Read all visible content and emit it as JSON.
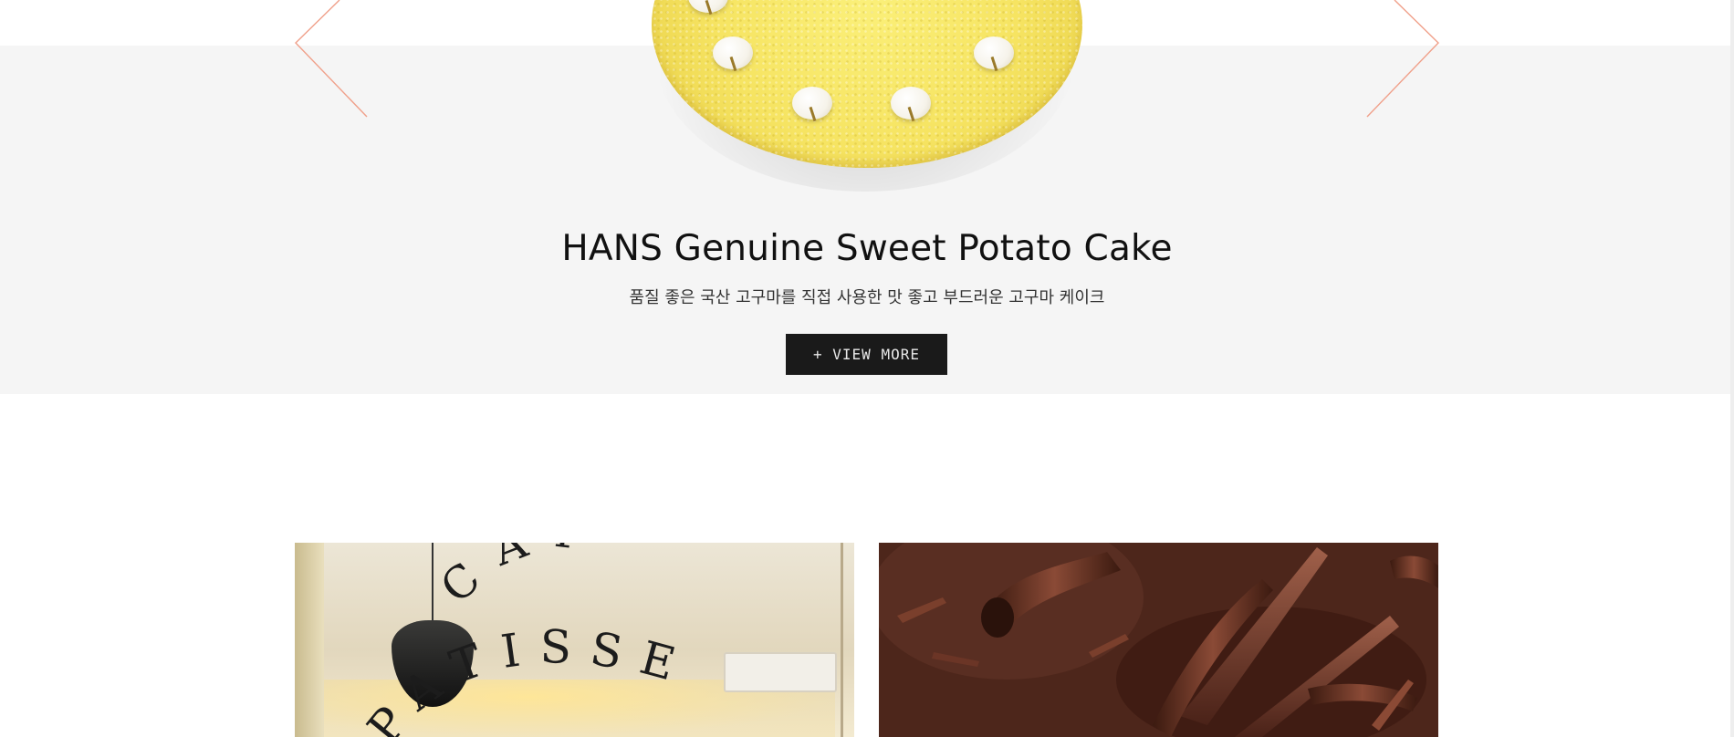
{
  "hero": {
    "title": "HANS Genuine Sweet Potato Cake",
    "description": "품질 좋은 국산 고구마를 직접 사용한 맛 좋고 부드러운 고구마 케이크",
    "button_label": "+ VIEW MORE",
    "accent_color": "#f0a08a",
    "background_color": "#f5f5f5",
    "prev_icon": "chevron-left-icon",
    "next_icon": "chevron-right-icon"
  },
  "gallery": {
    "left_sign": {
      "line1": "CAFE",
      "line2": "PATISSERIE"
    }
  }
}
